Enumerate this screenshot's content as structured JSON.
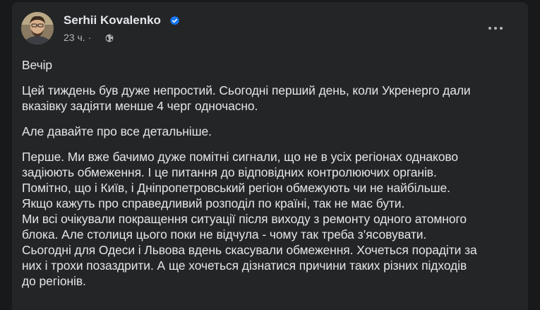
{
  "post": {
    "author": {
      "name": "Serhii Kovalenko",
      "verified_icon": "verified-badge-icon",
      "avatar_icon": "avatar-photo"
    },
    "meta": {
      "time": "23 ч.",
      "separator": "·",
      "privacy_icon": "globe-icon"
    },
    "menu_icon": "more-dots-icon",
    "paragraphs": [
      {
        "lines": [
          "Вечір"
        ]
      },
      {
        "lines": [
          "Цей тиждень був дуже непростий. Сьогодні перший день, коли Укренерго дали",
          "вказівку задіяти менше 4 черг одночасно."
        ]
      },
      {
        "lines": [
          "Але давайте про все детальніше."
        ]
      },
      {
        "lines": [
          "Перше. Ми вже бачимо дуже помітні сигнали, що не в усіх регіонах однаково",
          "задіюють обмеження. І це питання до відповідних контролюючих органів.",
          "Помітно, що і Київ, і Дніпропетровський регіон обмежують чи не найбільше.",
          "Якщо кажуть про справедливий розподіл по країні, так не має бути.",
          "Ми всі очікували покращення ситуації після виходу з ремонту одного атомного",
          "блока.  Але столиця цього поки не відчула - чому так треба з’ясовувати.",
          "Сьогодні для Одеси і Львова  вдень скасували обмеження. Хочеться порадіти за",
          "них і трохи позаздрити. А ще хочеться дізнатися причини таких різних підходів",
          "до регіонів."
        ]
      }
    ]
  },
  "colors": {
    "page_background": "#18191a",
    "card_background": "#242526",
    "primary_text": "#e4e6eb",
    "secondary_text": "#b0b3b8",
    "verified_blue": "#1877f2"
  }
}
